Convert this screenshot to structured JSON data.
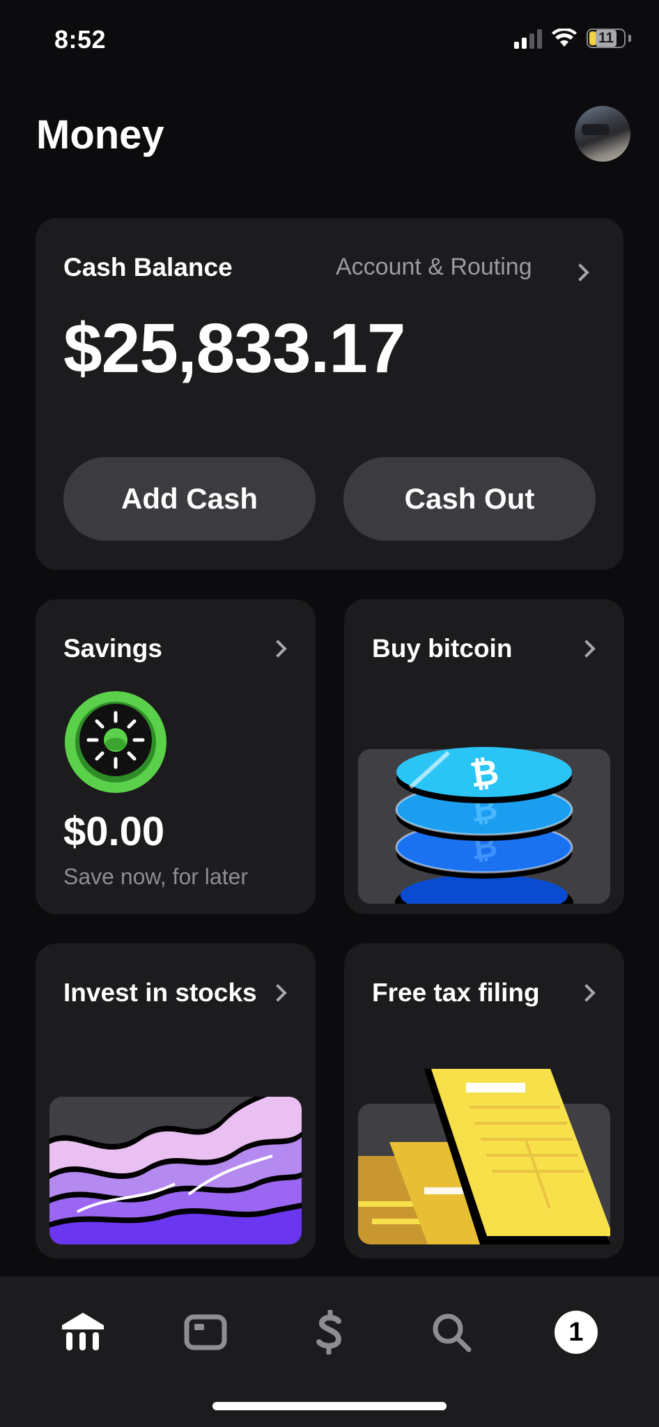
{
  "status_bar": {
    "time": "8:52",
    "battery": "11"
  },
  "header": {
    "title": "Money"
  },
  "balance_card": {
    "label": "Cash Balance",
    "link": "Account & Routing",
    "amount": "$25,833.17",
    "add_cash_label": "Add Cash",
    "cash_out_label": "Cash Out"
  },
  "savings_card": {
    "label": "Savings",
    "amount": "$0.00",
    "subtitle": "Save now, for later"
  },
  "bitcoin_card": {
    "label": "Buy bitcoin"
  },
  "stocks_card": {
    "label": "Invest in stocks"
  },
  "tax_card": {
    "label": "Free tax filing"
  },
  "bottom_nav": {
    "items": [
      {
        "icon": "bank-icon",
        "active": true
      },
      {
        "icon": "card-icon",
        "active": false
      },
      {
        "icon": "dollar-icon",
        "active": false
      },
      {
        "icon": "search-icon",
        "active": false
      },
      {
        "icon": "activity-badge",
        "badge": "1",
        "active": false
      }
    ]
  },
  "colors": {
    "background": "#0c0c0e",
    "card": "#1c1c1e",
    "button": "#3c3c40",
    "muted_text": "#9c9ca0",
    "savings_green": "#5bd04a",
    "bitcoin_blue": "#1fb8f0",
    "stocks_purple": "#7b45f0",
    "tax_yellow": "#f7e04a"
  }
}
